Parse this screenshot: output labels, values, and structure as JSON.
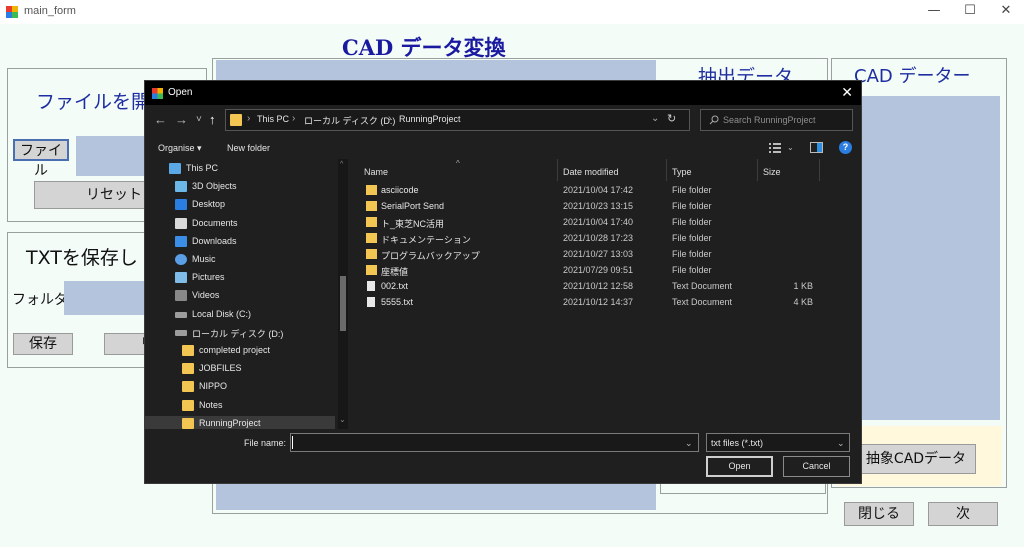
{
  "window": {
    "title": "main_form",
    "minimize": "—",
    "maximize": "☐",
    "close": "✕"
  },
  "main": {
    "heading": "CAD データ変換",
    "open_file": {
      "title": "ファイルを開",
      "file_button": "ファイル",
      "reset_button": "リセット"
    },
    "save_txt": {
      "title": "TXTを保存し",
      "folder_label": "フォルダ",
      "save_button": "保存",
      "reset_button": "リセ"
    },
    "extract_title": "抽出データ",
    "cad_data_title": "CAD データー",
    "extract_cad_button": "抽象CADデータ",
    "close_button": "閉じる",
    "next_button": "次"
  },
  "dialog": {
    "title": "Open",
    "close": "✕",
    "nav": {
      "back": "←",
      "forward": "→",
      "recent": "˅",
      "up": "↑"
    },
    "address": [
      "This PC",
      "ローカル ディスク (D:)",
      "RunningProject"
    ],
    "address_sep": "›",
    "refresh": "↻",
    "search_placeholder": "Search RunningProject",
    "toolbar": {
      "organise": "Organise ▾",
      "new_folder": "New folder",
      "help": "?"
    },
    "nav_items": [
      {
        "label": "This PC",
        "icon": "pc-icon"
      },
      {
        "label": "3D Objects",
        "icon": "cube-icon"
      },
      {
        "label": "Desktop",
        "icon": "desktop-icon"
      },
      {
        "label": "Documents",
        "icon": "document-icon"
      },
      {
        "label": "Downloads",
        "icon": "download-icon"
      },
      {
        "label": "Music",
        "icon": "music-icon"
      },
      {
        "label": "Pictures",
        "icon": "picture-icon"
      },
      {
        "label": "Videos",
        "icon": "video-icon"
      },
      {
        "label": "Local Disk (C:)",
        "icon": "drive-icon"
      },
      {
        "label": "ローカル ディスク (D:)",
        "icon": "drive-icon"
      },
      {
        "label": "completed project",
        "icon": "folder-icon"
      },
      {
        "label": "JOBFILES",
        "icon": "folder-icon"
      },
      {
        "label": "NIPPO",
        "icon": "folder-icon"
      },
      {
        "label": "Notes",
        "icon": "folder-icon"
      },
      {
        "label": "RunningProject",
        "icon": "folder-icon"
      }
    ],
    "columns": [
      "Name",
      "Date modified",
      "Type",
      "Size"
    ],
    "files": [
      {
        "name": "asciicode",
        "date": "2021/10/04 17:42",
        "type": "File folder",
        "size": "",
        "kind": "folder"
      },
      {
        "name": "SerialPort Send",
        "date": "2021/10/23 13:15",
        "type": "File folder",
        "size": "",
        "kind": "folder"
      },
      {
        "name": "ト_東芝NC活用",
        "date": "2021/10/04 17:40",
        "type": "File folder",
        "size": "",
        "kind": "folder"
      },
      {
        "name": "ドキュメンテーション",
        "date": "2021/10/28 17:23",
        "type": "File folder",
        "size": "",
        "kind": "folder"
      },
      {
        "name": "プログラムバックアップ",
        "date": "2021/10/27 13:03",
        "type": "File folder",
        "size": "",
        "kind": "folder"
      },
      {
        "name": "座標値",
        "date": "2021/07/29 09:51",
        "type": "File folder",
        "size": "",
        "kind": "folder"
      },
      {
        "name": "002.txt",
        "date": "2021/10/12 12:58",
        "type": "Text Document",
        "size": "1 KB",
        "kind": "file"
      },
      {
        "name": "5555.txt",
        "date": "2021/10/12 14:37",
        "type": "Text Document",
        "size": "4 KB",
        "kind": "file"
      }
    ],
    "file_name_label": "File name:",
    "file_name_value": "",
    "file_type": "txt files (*.txt)",
    "open_button": "Open",
    "cancel_button": "Cancel",
    "chevron": "⌄",
    "sort_indicator": "^"
  },
  "colors": {
    "form_bg": "#f4fcf8",
    "heading_blue": "#1a1aa0",
    "panel_blue": "#b4c4dc",
    "dialog_bg": "#1f1f1f",
    "folder_yellow": "#f3c552"
  }
}
